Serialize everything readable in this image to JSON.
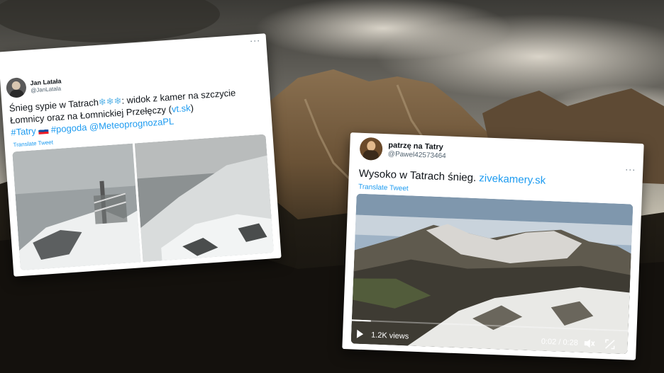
{
  "tweet1": {
    "user_name": "Jan Latała",
    "user_handle": "@JanLatala",
    "text_part1": "Śnieg sypie w Tatrach",
    "snow_emoji": "❄❄❄",
    "text_part2": ": widok z kamer na szczycie Łomnicy oraz na Łomnickiej Przełęczy (",
    "link": "vt.sk",
    "text_part3": ")",
    "hashtag_tatry": "#Tatry",
    "hashtag_pogoda": "#pogoda",
    "mention": "@MeteoprognozaPL",
    "translate": "Translate Tweet",
    "more": "···"
  },
  "tweet2": {
    "user_name": "patrzę na Tatry",
    "user_handle": "@Pawel42573464",
    "text": "Wysoko w Tatrach śnieg. ",
    "link": "zivekamery.sk",
    "translate": "Translate Tweet",
    "more": "···",
    "video": {
      "views": "1.2K views",
      "time": "0:02 / 0:28",
      "progress": 0.07
    }
  },
  "icons": {
    "play": "play-icon",
    "mute": "mute-icon",
    "fullscreen": "fullscreen-icon",
    "flag": "slovakia-flag-icon"
  }
}
